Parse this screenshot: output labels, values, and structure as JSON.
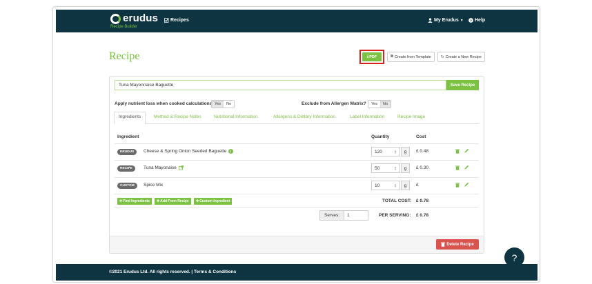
{
  "brand": {
    "name": "erudus",
    "sub": "Recipe Builder"
  },
  "nav": {
    "recipes": "Recipes",
    "account": "My Erudus",
    "help": "Help"
  },
  "page": {
    "title": "Recipe"
  },
  "header_buttons": {
    "pdf": "PDF",
    "create_from_template": "Create from Template",
    "create_new": "Create a New Recipe"
  },
  "recipe": {
    "name": "Tuna Mayonnaise Baguette",
    "save_label": "Save Recipe"
  },
  "options": {
    "nutrient_loss_label": "Apply nutrient loss when cooked calculations :",
    "allergen_exclude_label": "Exclude from Allergen Matrix? :",
    "yes": "Yes",
    "no": "No"
  },
  "tabs": [
    {
      "label": "Ingredients"
    },
    {
      "label": "Method & Recipe Notes"
    },
    {
      "label": "Nutritional Information"
    },
    {
      "label": "Allergens & Dietary Information"
    },
    {
      "label": "Label Information"
    },
    {
      "label": "Recipe Image"
    }
  ],
  "table": {
    "headers": {
      "ingredient": "Ingredient",
      "quantity": "Quantity",
      "cost": "Cost"
    },
    "rows": [
      {
        "badge": "ERUDUS",
        "name": "Cheese & Spring Onion Seeded Baguette",
        "icon": "info-icon",
        "quantity": "120",
        "unit": "g",
        "cost": "£ 0.48"
      },
      {
        "badge": "RECIPE",
        "name": "Tuna Mayonaise",
        "icon": "external-link-icon",
        "quantity": "50",
        "unit": "g",
        "cost": "£ 0.30"
      },
      {
        "badge": "CUSTOM",
        "name": "Spice Mix",
        "icon": "",
        "quantity": "10",
        "unit": "g",
        "cost": "£"
      }
    ]
  },
  "add_buttons": {
    "find": "Find Ingredients",
    "from_recipe": "Add From Recipe",
    "custom": "Custom Ingredient"
  },
  "totals": {
    "total_cost_label": "TOTAL COST:",
    "total_cost": "£ 0.78",
    "per_serving_label": "PER SERVING:",
    "per_serving": "£ 0.78",
    "serves_label": "Serves:",
    "serves": "1"
  },
  "delete_label": "Delete Recipe",
  "help_fab": "?",
  "footer": {
    "text": "©2021 Erudus Ltd. All rights reserved. | Terms & Conditions"
  },
  "colors": {
    "brand_dark": "#0d3440",
    "accent_green": "#7cc242",
    "danger": "#d9534f",
    "highlight_red": "#d9211c"
  }
}
